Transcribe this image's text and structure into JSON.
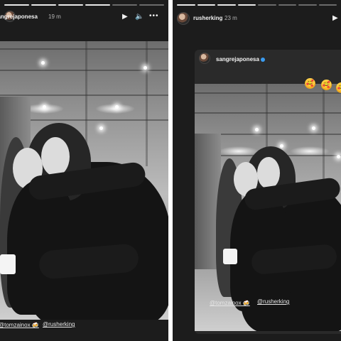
{
  "left_story": {
    "username": "sangrejaponesa",
    "time": "19 m",
    "progress_bars": [
      1,
      1,
      1,
      1,
      0,
      0
    ],
    "controls": {
      "play": "▶",
      "mute": "🔈",
      "more": "•••"
    },
    "mentions": [
      "@tomzainox 🍻",
      "@rusherking"
    ]
  },
  "right_story": {
    "username": "rusherking",
    "time": "23 m",
    "progress_bars": [
      1,
      1,
      1,
      1,
      0,
      0,
      0,
      0
    ],
    "controls": {
      "play": "▶"
    },
    "repost_username": "sangrejaponesa",
    "emojis": [
      "🥰",
      "🥰",
      "🥰"
    ],
    "mentions": [
      "@tomzainox 🍻",
      "@rusherking"
    ]
  },
  "colors": {
    "story_bg": "#1c1c1c",
    "verified": "#3b9cf0"
  }
}
